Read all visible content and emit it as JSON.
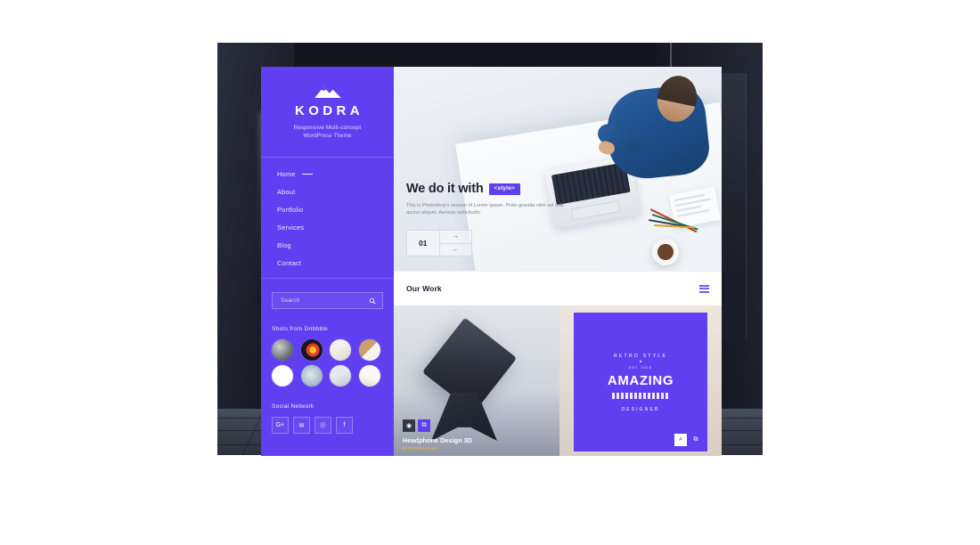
{
  "sidebar": {
    "logo_icon": "mountain-icon",
    "brand_name": "KODRA",
    "brand_tagline_line1": "Responsive Multi-concept",
    "brand_tagline_line2": "WordPress Theme",
    "nav": [
      {
        "label": "Home",
        "active": true
      },
      {
        "label": "About",
        "active": false
      },
      {
        "label": "Portfolio",
        "active": false
      },
      {
        "label": "Services",
        "active": false
      },
      {
        "label": "Blog",
        "active": false
      },
      {
        "label": "Contact",
        "active": false
      }
    ],
    "search": {
      "placeholder": "Search",
      "value": "",
      "icon": "search-icon"
    },
    "dribbble": {
      "title": "Shots from Dribbble",
      "thumbs": [
        "shot-thumbnail-1",
        "shot-thumbnail-2",
        "shot-thumbnail-3",
        "shot-thumbnail-4",
        "shot-thumbnail-5",
        "shot-thumbnail-6",
        "shot-thumbnail-7",
        "shot-thumbnail-8"
      ]
    },
    "social": {
      "title": "Social Network",
      "items": [
        {
          "name": "google-plus-icon",
          "glyph": "G+"
        },
        {
          "name": "twitter-icon",
          "glyph": "✉"
        },
        {
          "name": "pinterest-icon",
          "glyph": "ⓟ"
        },
        {
          "name": "facebook-icon",
          "glyph": "f"
        }
      ]
    },
    "bg_color": "#5f3ff0"
  },
  "hero": {
    "heading": "We do it with",
    "chip": "<style>",
    "paragraph": "This is Photoshop's version of Lorem Ipsum. Proin gravida nibh vel velit auctor aliquet. Aenean sollicitudin",
    "slide_number": "01",
    "next_arrow": "→",
    "prev_arrow": "←"
  },
  "work": {
    "title": "Our Work",
    "layout_icon": "grid-layout-icon"
  },
  "portfolio": [
    {
      "title": "Headphone Design 3D",
      "tags": "branding print",
      "icons": [
        {
          "name": "link-icon",
          "glyph": "◉"
        },
        {
          "name": "expand-icon",
          "glyph": "⧉"
        }
      ]
    },
    {
      "badge_top": "RETRO STYLE",
      "badge_est": "EST. 2015",
      "badge_main": "AMAZING",
      "badge_bottom": "DESIGNER",
      "icons": [
        {
          "name": "search-zoom-icon",
          "glyph": "⌕"
        },
        {
          "name": "expand-icon",
          "glyph": "⧉"
        }
      ]
    }
  ],
  "theme": {
    "accent": "#5f3ff0",
    "tag_color": "#f0b429",
    "dark_text": "#1c2233"
  }
}
